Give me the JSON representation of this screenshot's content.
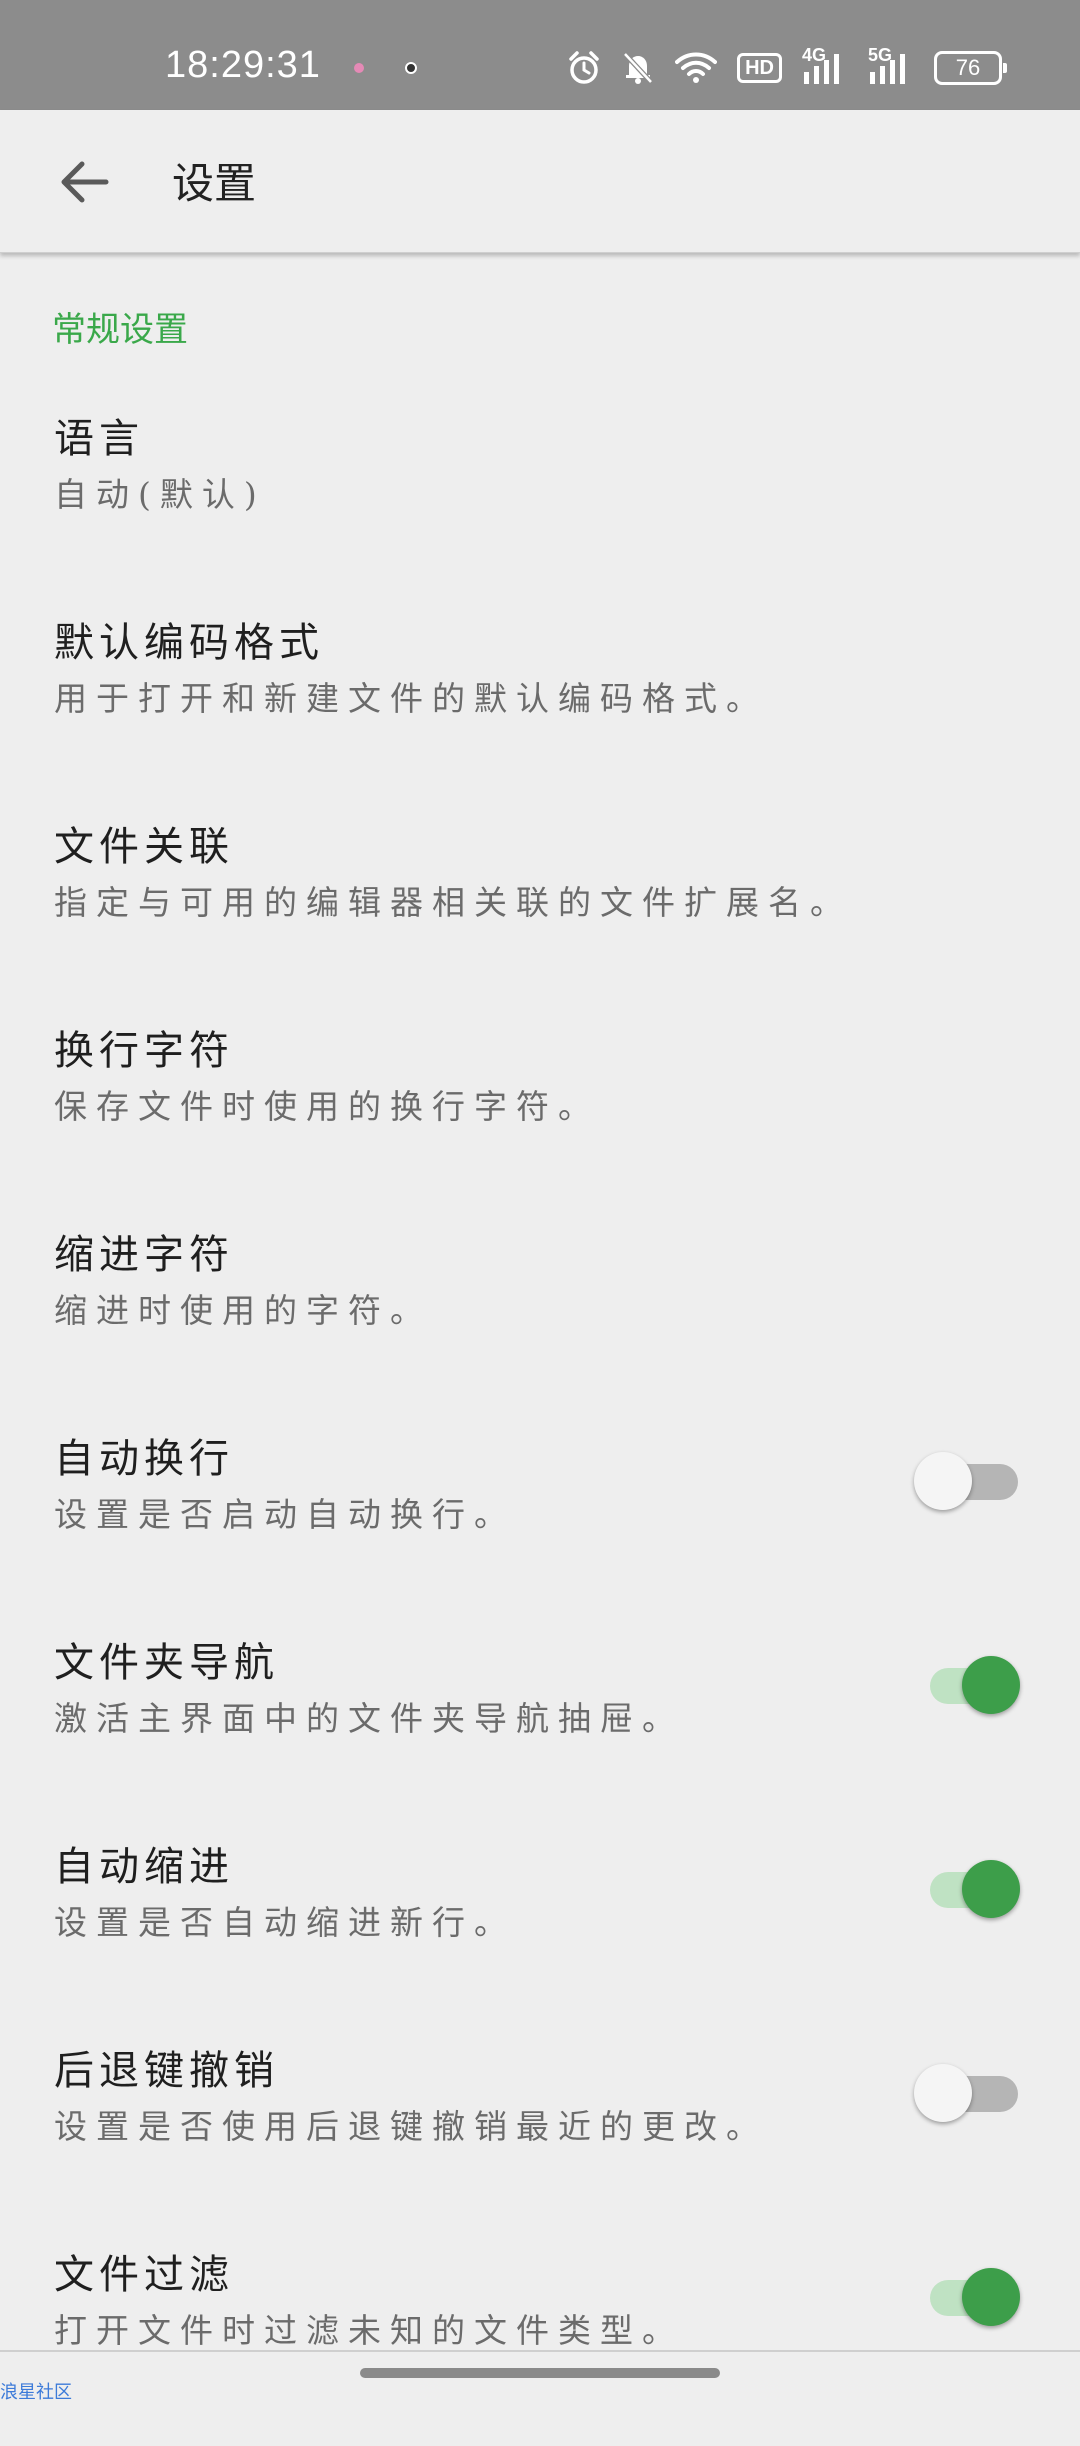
{
  "status_bar": {
    "time": "18:29:31",
    "network_4g": "4G",
    "network_5g": "5G",
    "hd_label": "HD",
    "battery": "76",
    "icons": [
      "alarm-icon",
      "bell-muted-icon",
      "wifi-icon",
      "hd-icon",
      "signal-4g-icon",
      "signal-5g-icon",
      "battery-icon"
    ]
  },
  "app_bar": {
    "title": "设置",
    "back_icon": "arrow-left-icon"
  },
  "section": {
    "header": "常规设置"
  },
  "preferences": [
    {
      "title": "语言",
      "summary": "自动(默认)",
      "switch": null
    },
    {
      "title": "默认编码格式",
      "summary": "用于打开和新建文件的默认编码格式。",
      "switch": null
    },
    {
      "title": "文件关联",
      "summary": "指定与可用的编辑器相关联的文件扩展名。",
      "switch": null
    },
    {
      "title": "换行字符",
      "summary": "保存文件时使用的换行字符。",
      "switch": null
    },
    {
      "title": "缩进字符",
      "summary": "缩进时使用的字符。",
      "switch": null
    },
    {
      "title": "自动换行",
      "summary": "设置是否启动自动换行。",
      "switch": "off"
    },
    {
      "title": "文件夹导航",
      "summary": "激活主界面中的文件夹导航抽屉。",
      "switch": "on"
    },
    {
      "title": "自动缩进",
      "summary": "设置是否自动缩进新行。",
      "switch": "on"
    },
    {
      "title": "后退键撤销",
      "summary": "设置是否使用后退键撤销最近的更改。",
      "switch": "off"
    },
    {
      "title": "文件过滤",
      "summary": "打开文件时过滤未知的文件类型。",
      "switch": "on"
    }
  ],
  "colors": {
    "accent": "#3aa84a",
    "switch_on_thumb": "#3d9e4a",
    "switch_on_track": "#bfe2c3",
    "switch_off_track": "#b5b5b5",
    "status_bar_bg": "#8c8c8c",
    "background": "#eeeeee"
  },
  "watermark": "浪星社区"
}
